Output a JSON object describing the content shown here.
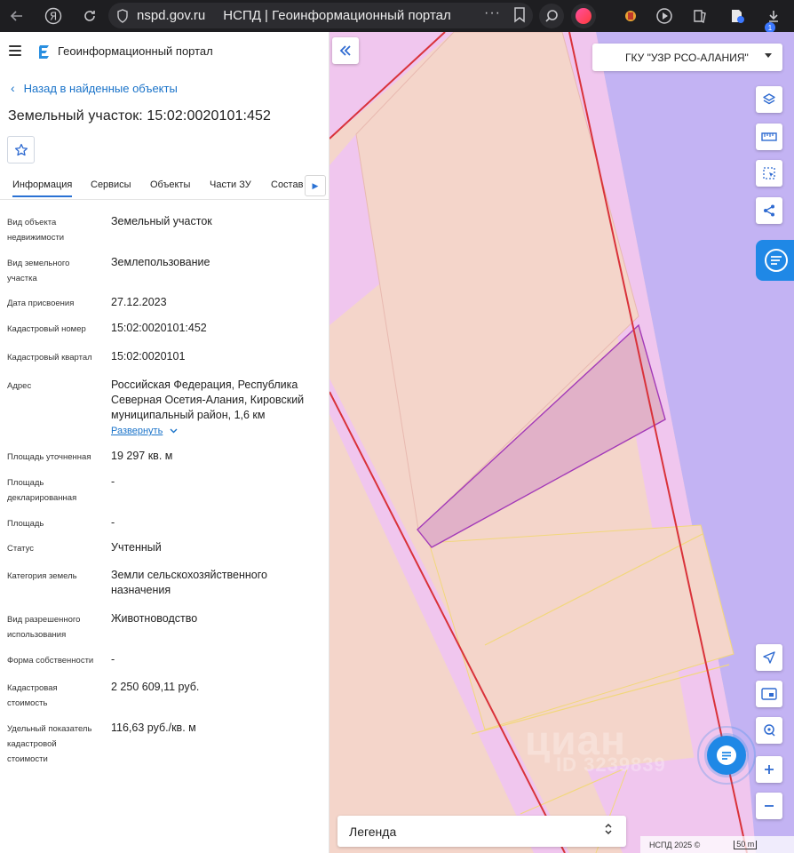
{
  "browser": {
    "url": "nspd.gov.ru",
    "tab_title": "НСПД | Геоинформационный портал",
    "downloads_badge": "1"
  },
  "header": {
    "app_title": "Геоинформационный портал"
  },
  "nav": {
    "back_label": "Назад в найденные объекты"
  },
  "object": {
    "title": "Земельный участок: 15:02:0020101:452"
  },
  "tabs": [
    {
      "label": "Информация"
    },
    {
      "label": "Сервисы"
    },
    {
      "label": "Объекты"
    },
    {
      "label": "Части ЗУ"
    },
    {
      "label": "Состав"
    }
  ],
  "props": {
    "object_type": {
      "label": [
        "Вид объекта",
        "недвижимости"
      ],
      "value": "Земельный участок"
    },
    "plot_type": {
      "label": [
        "Вид земельного",
        "участка"
      ],
      "value": "Землепользование"
    },
    "assigned_date": {
      "label": [
        "Дата присвоения"
      ],
      "value": "27.12.2023"
    },
    "cadastral_number": {
      "label": [
        "Кадастровый номер"
      ],
      "value": "15:02:0020101:452"
    },
    "cadastral_block": {
      "label": [
        "Кадастровый квартал"
      ],
      "value": "15:02:0020101"
    },
    "address": {
      "label": [
        "Адрес"
      ],
      "value": [
        "Российская Федерация, Республика",
        "Северная Осетия-Алания, Кировский",
        "муниципальный район, 1,6 км"
      ],
      "expand_label": "Развернуть"
    },
    "area_refined": {
      "label": [
        "Площадь уточненная"
      ],
      "value": "19 297 кв. м"
    },
    "area_declared": {
      "label": [
        "Площадь",
        "декларированная"
      ],
      "value": "-"
    },
    "area": {
      "label": [
        "Площадь"
      ],
      "value": "-"
    },
    "status": {
      "label": [
        "Статус"
      ],
      "value": "Учтенный"
    },
    "land_category": {
      "label": [
        "Категория земель"
      ],
      "value": [
        "Земли сельскохозяйственного",
        "назначения"
      ]
    },
    "permitted_use": {
      "label": [
        "Вид разрешенного",
        "использования"
      ],
      "value": "Животноводство"
    },
    "ownership": {
      "label": [
        "Форма собственности"
      ],
      "value": "-"
    },
    "cadastral_value": {
      "label": [
        "Кадастровая",
        "стоимость"
      ],
      "value": "2 250 609,11 руб."
    },
    "specific_value": {
      "label": [
        "Удельный показатель",
        "кадастровой",
        "стоимости"
      ],
      "value": "116,63 руб./кв. м"
    }
  },
  "map": {
    "org_selector": "ГКУ \"УЗР РСО-АЛАНИЯ\"",
    "legend_label": "Легенда",
    "attribution": "НСПД 2025 ©",
    "scale": "50 m",
    "watermark": "циан",
    "watermark_id": "ID 3239839",
    "colors": {
      "zone_pink": "#f0c6ee",
      "zone_purple": "#c3b3f3",
      "parcel": "#f4d5ca",
      "selected_fill": "#e1b1c8",
      "selected_stroke": "#a33ab8",
      "border_red": "#d9323a",
      "line_yellow": "#f2d77c"
    }
  }
}
